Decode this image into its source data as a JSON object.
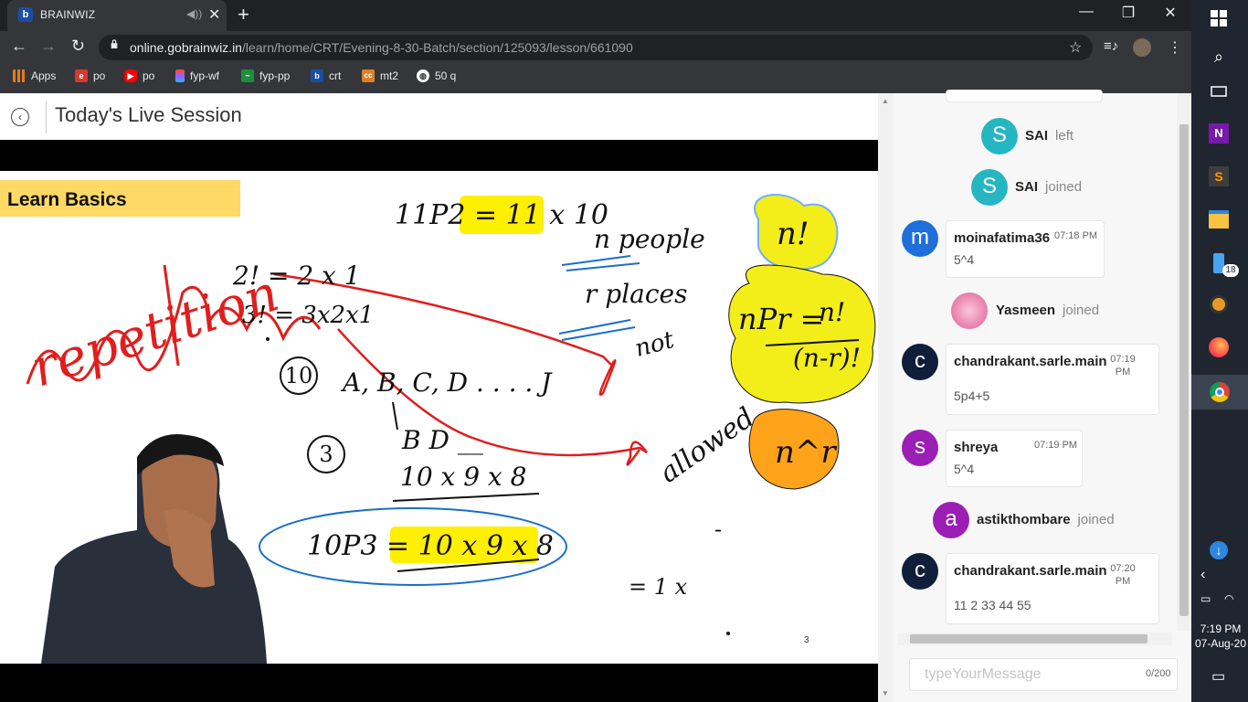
{
  "browser": {
    "tab_title": "BRAINWIZ",
    "tab_favicon": "b",
    "url_host": "online.gobrainwiz.in",
    "url_path": "/learn/home/CRT/Evening-8-30-Batch/section/125093/lesson/661090",
    "bookmarks": [
      {
        "label": "Apps",
        "icon": "apps-grid-icon"
      },
      {
        "label": "po",
        "icon": "e"
      },
      {
        "label": "po",
        "icon": "youtube-icon"
      },
      {
        "label": "fyp-wf",
        "icon": "figma-icon"
      },
      {
        "label": "fyp-pp",
        "icon": "chart-icon"
      },
      {
        "label": "crt",
        "icon": "b"
      },
      {
        "label": "mt2",
        "icon": "cc"
      },
      {
        "label": "50 q",
        "icon": "globe-icon"
      }
    ]
  },
  "page": {
    "title": "Today's Live Session"
  },
  "slide": {
    "banner": "Learn Basics",
    "slide_number": "3",
    "handwriting": {
      "npr_top": "11P2 = 11 x 10",
      "n_people": "n people",
      "r_places": "r places",
      "not": "not",
      "fact2": "2! = 2 x 1",
      "fact3": "3! = 3x2x1",
      "repetition": "repetition",
      "ten_circle": "10",
      "letters": "A, B, C, D . . . . J",
      "three_circle": "3",
      "bd": "B  D  __",
      "product": "10 x 9 x 8",
      "allowed": "allowed",
      "npr_bottom": "10P3 = 10 x 9 x 8",
      "eq1": "= 1  x",
      "dash": "-",
      "nfact": "n!",
      "npr_formula_left": "nPr =",
      "npr_formula_num": "n!",
      "npr_formula_den": "(n-r)!",
      "n_pow_r": "n^r"
    }
  },
  "chat": {
    "placeholder": "typeYourMessage",
    "counter": "0/200",
    "events": [
      {
        "type": "join",
        "name": "SAI",
        "status": "left",
        "initial": "S",
        "color": "#26b6c1"
      },
      {
        "type": "join",
        "name": "SAI",
        "status": "joined",
        "initial": "S",
        "color": "#26b6c1"
      },
      {
        "type": "msg",
        "name": "moinafatima36",
        "time": "07:18 PM",
        "text": "5^4",
        "initial": "m",
        "color": "#1e6fd9"
      },
      {
        "type": "join",
        "name": "Yasmeen",
        "status": "joined",
        "initial": "",
        "color": "#e98bb4"
      },
      {
        "type": "msg",
        "name": "chandrakant.sarle.main",
        "time": "07:19 PM",
        "text": "5p4+5",
        "initial": "c",
        "color": "#0f1e3a"
      },
      {
        "type": "msg",
        "name": "shreya",
        "time": "07:19 PM",
        "text": "5^4",
        "initial": "s",
        "color": "#9b1fb4"
      },
      {
        "type": "join",
        "name": "astikthombare",
        "status": "joined",
        "initial": "a",
        "color": "#9b1fb4"
      },
      {
        "type": "msg",
        "name": "chandrakant.sarle.main",
        "time": "07:20 PM",
        "text": "11 2 33 44 55",
        "initial": "c",
        "color": "#0f1e3a"
      }
    ]
  },
  "taskbar": {
    "time": "7:19 PM",
    "date": "07-Aug-20",
    "badge": "18"
  }
}
